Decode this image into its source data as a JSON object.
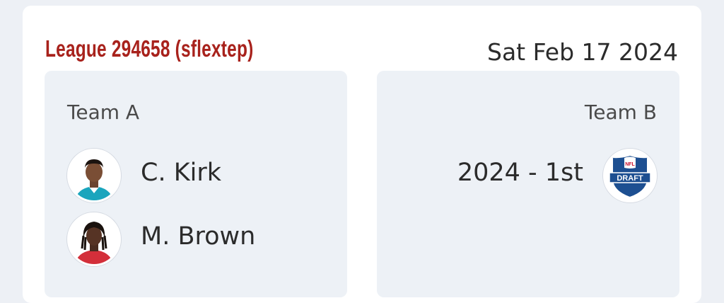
{
  "league": {
    "name": "League 294658 (sflextep)"
  },
  "date": "Sat Feb 17 2024",
  "team_a": {
    "label": "Team A",
    "players": [
      {
        "name": "C. Kirk"
      },
      {
        "name": "M. Brown"
      }
    ]
  },
  "team_b": {
    "label": "Team B",
    "picks": [
      {
        "label": "2024 - 1st",
        "badge_top": "NFL",
        "badge_text": "DRAFT"
      }
    ]
  },
  "colors": {
    "league_title": "#a8221c",
    "panel_bg": "#edf1f6",
    "page_bg": "#edf0f5",
    "draft_blue": "#1d4f91",
    "draft_red": "#c8102e"
  }
}
